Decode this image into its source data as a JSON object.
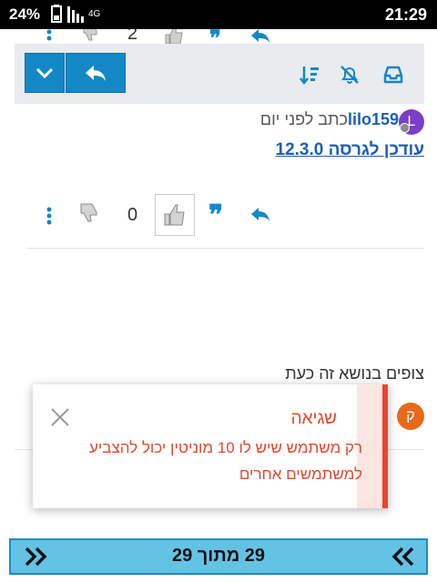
{
  "status_bar": {
    "battery": "24%",
    "network": "4G",
    "time": "21:29"
  },
  "toolbar": {
    "icons": [
      "inbox-icon",
      "mute-bell-icon",
      "sort-icon"
    ],
    "buttons": [
      "reply-icon",
      "chevron-down-icon"
    ]
  },
  "post": {
    "avatar_letter": "L",
    "author": "lilo159",
    "meta": "כתב לפני יום",
    "link_text": "עודכן לגרסה 12.3.0",
    "vote_count": "0",
    "top_partial_count": "2"
  },
  "watching": {
    "label": "צופים בנושא זה כעת",
    "avatar_letter": "ק"
  },
  "toast": {
    "title": "שגיאה",
    "message": "רק משתמש שיש לו 10 מוניטין יכול להצביע למשתמשים אחרים"
  },
  "pagination": {
    "label": "29 מתוך 29"
  },
  "colors": {
    "accent": "#1488c6",
    "error": "#e8452c",
    "link": "#1a5fb4",
    "pagebar": "#63c3e5"
  }
}
